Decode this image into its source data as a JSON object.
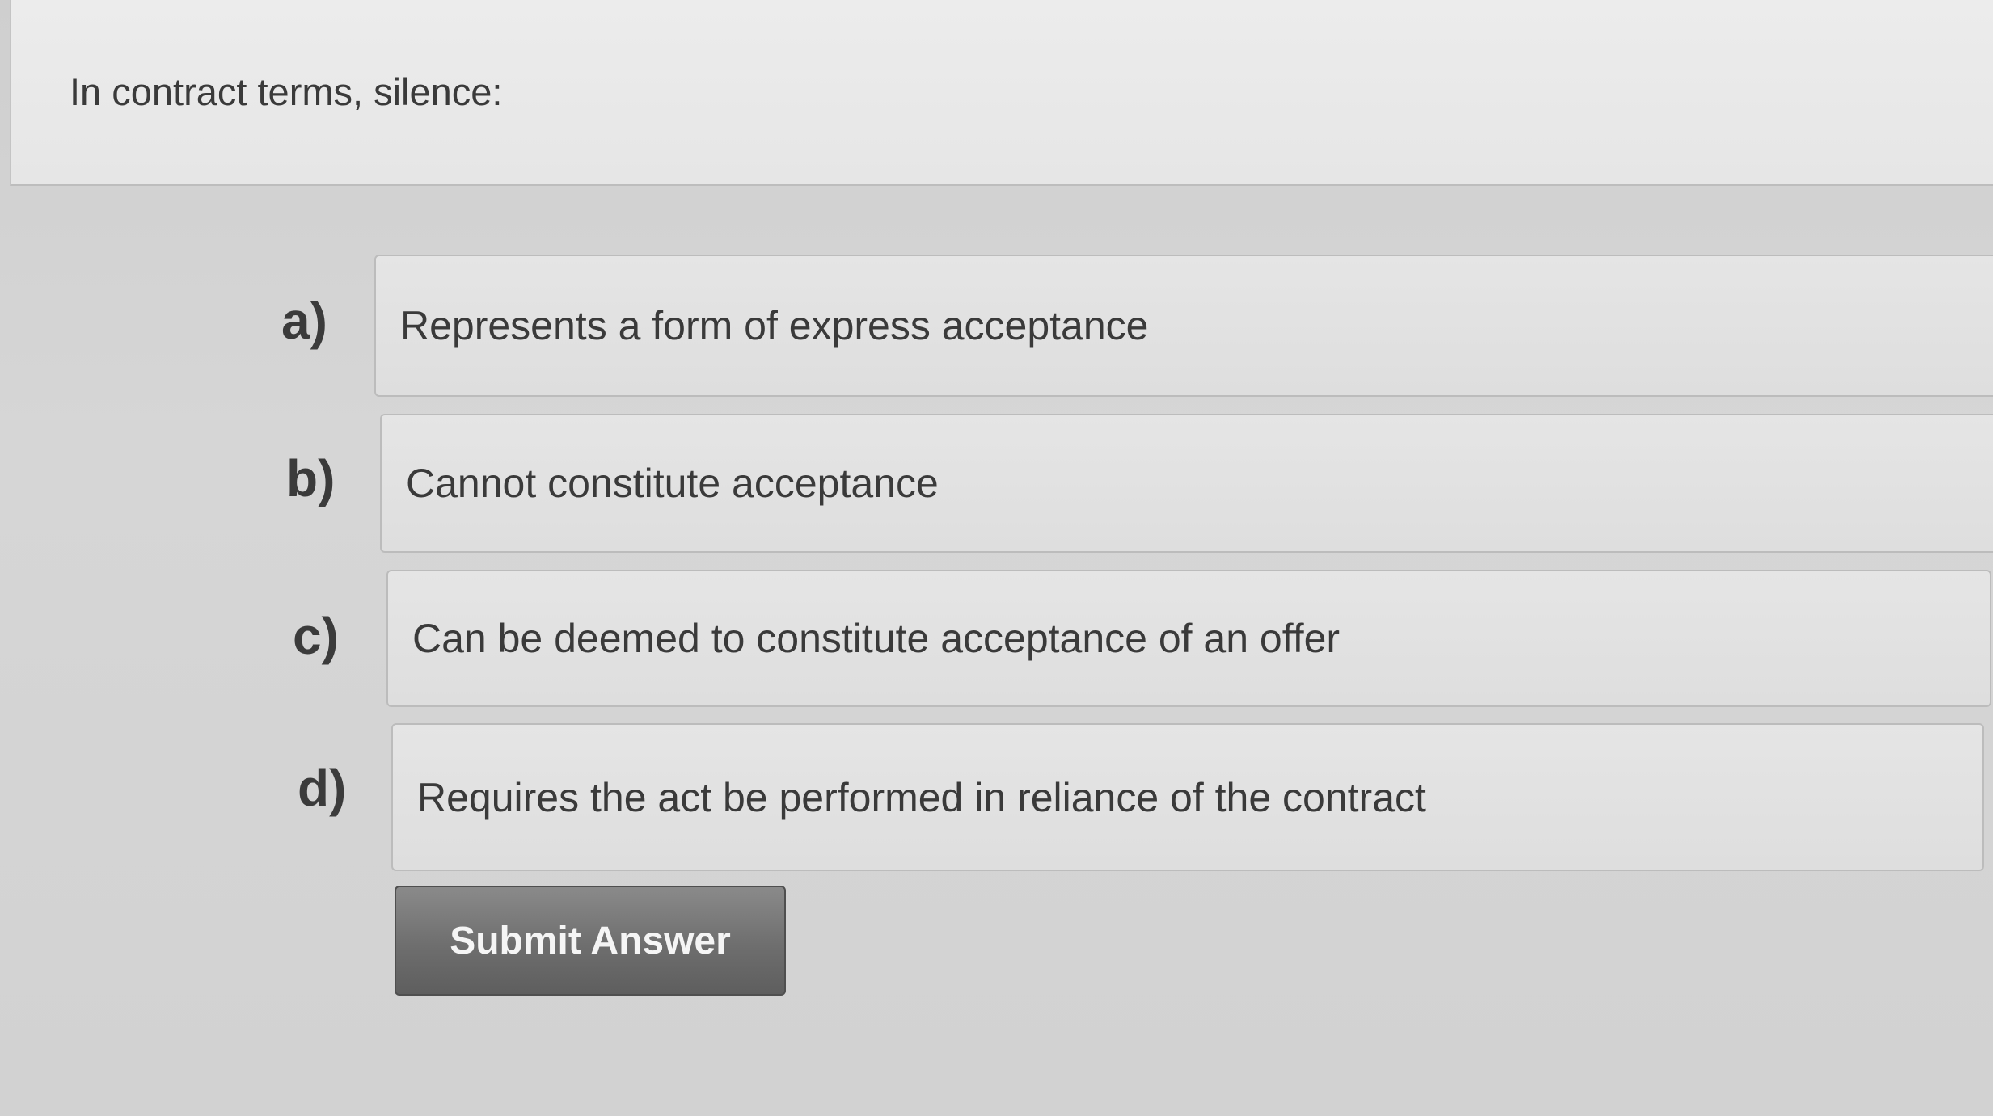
{
  "question": {
    "text": "In contract terms, silence:"
  },
  "options": [
    {
      "letter": "a)",
      "text": "Represents a form of express acceptance"
    },
    {
      "letter": "b)",
      "text": "Cannot constitute acceptance"
    },
    {
      "letter": "c)",
      "text": "Can be deemed to constitute acceptance of an offer"
    },
    {
      "letter": "d)",
      "text": "Requires the act be performed in reliance of the contract"
    }
  ],
  "submit": {
    "label": "Submit Answer"
  }
}
